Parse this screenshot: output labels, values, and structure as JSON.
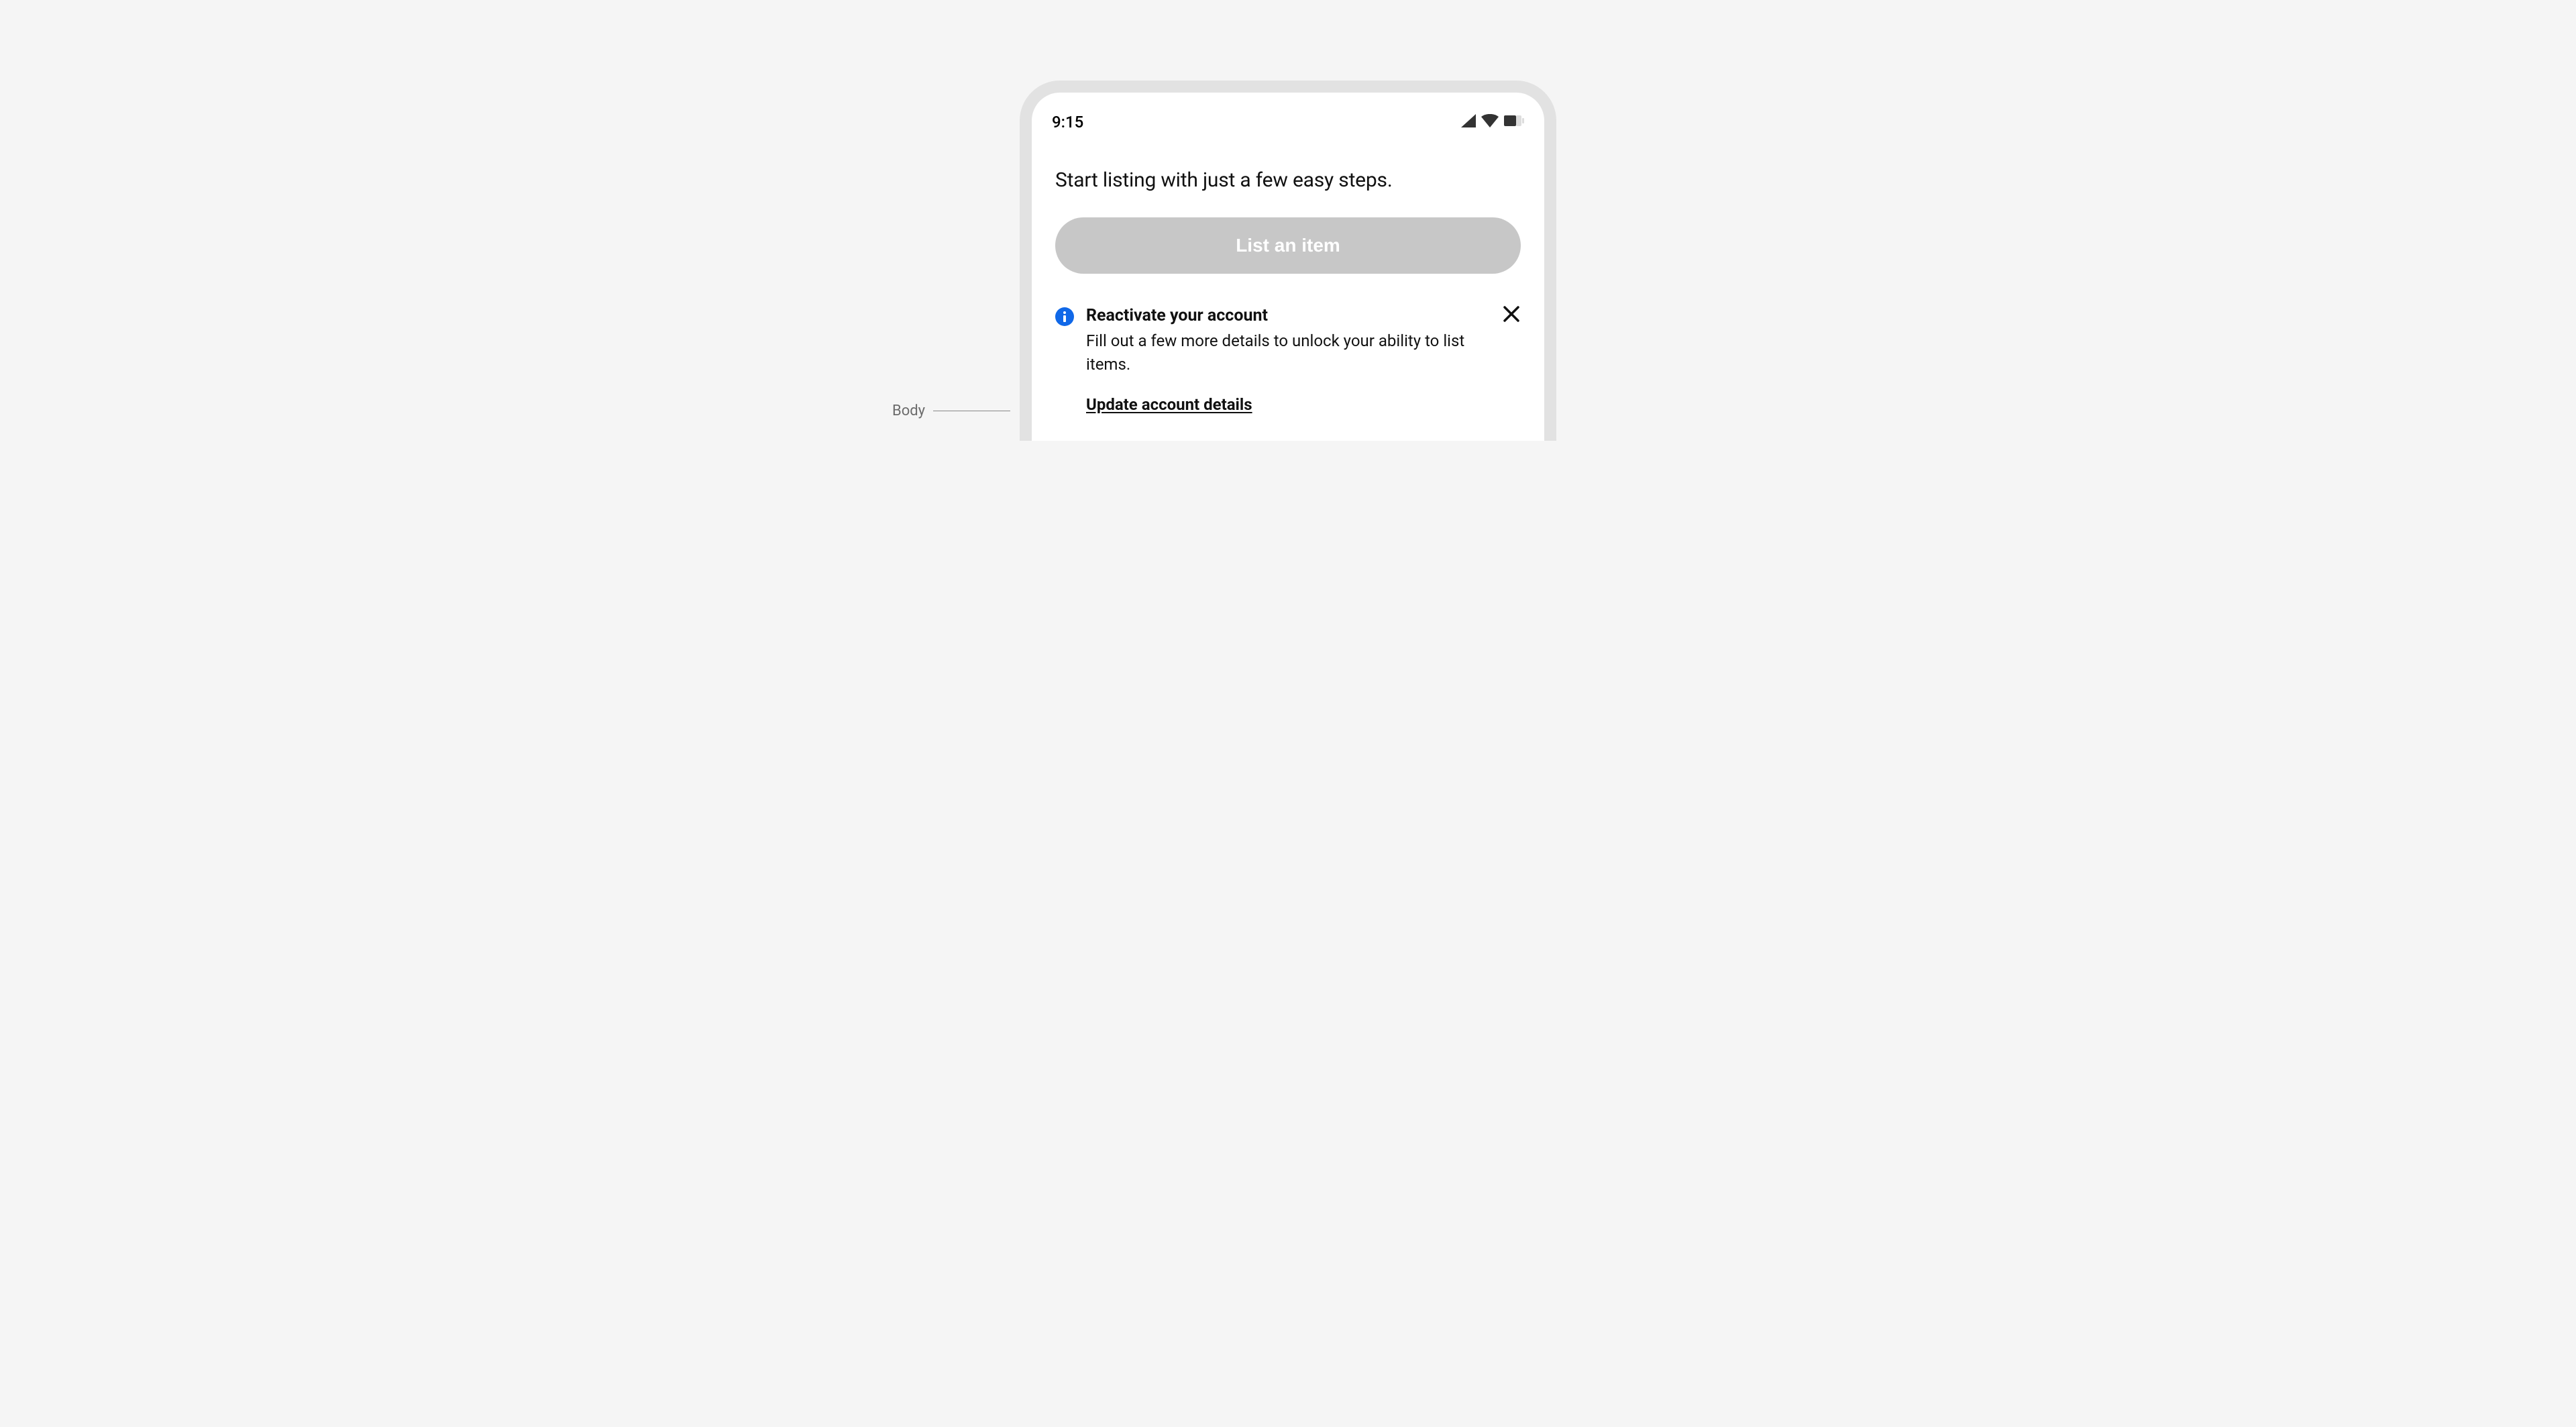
{
  "status_bar": {
    "time": "9:15"
  },
  "page": {
    "heading": "Start listing with just a few easy steps.",
    "primary_button_label": "List an item"
  },
  "notice": {
    "title": "Reactivate your account",
    "body": "Fill out a few more details to unlock your ability to list items.",
    "link_label": "Update account details"
  },
  "annotations": {
    "body_label": "Body"
  },
  "colors": {
    "info_icon": "#1068e8",
    "disabled_button": "#c7c7c7"
  }
}
